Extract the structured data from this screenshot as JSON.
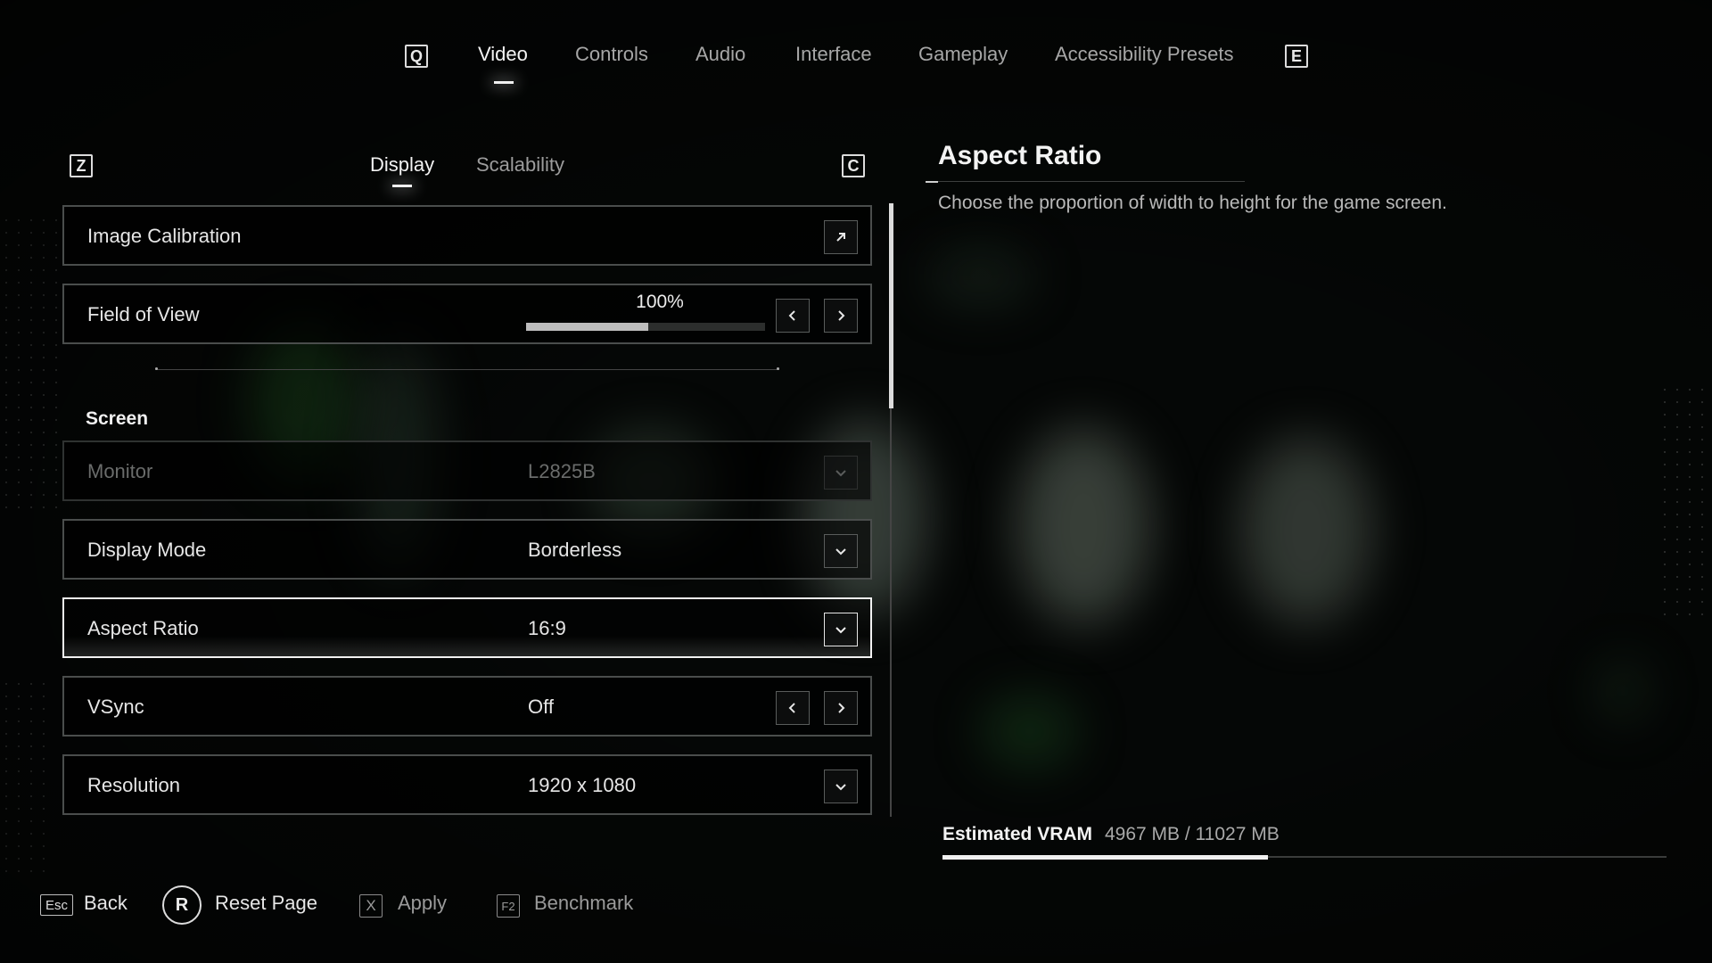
{
  "top_nav": {
    "left_key": "Q",
    "right_key": "E",
    "tabs": [
      {
        "label": "Video",
        "active": true
      },
      {
        "label": "Controls",
        "active": false
      },
      {
        "label": "Audio",
        "active": false
      },
      {
        "label": "Interface",
        "active": false
      },
      {
        "label": "Gameplay",
        "active": false
      },
      {
        "label": "Accessibility Presets",
        "active": false
      }
    ]
  },
  "sub_nav": {
    "left_key": "Z",
    "right_key": "C",
    "tabs": [
      {
        "label": "Display",
        "active": true
      },
      {
        "label": "Scalability",
        "active": false
      }
    ]
  },
  "settings": {
    "image_calibration": {
      "label": "Image Calibration",
      "icon": "external-link-icon"
    },
    "field_of_view": {
      "label": "Field of View",
      "value": "100%",
      "slider_fraction": 0.51
    },
    "section_screen": "Screen",
    "monitor": {
      "label": "Monitor",
      "value": "L2825B",
      "disabled": true
    },
    "display_mode": {
      "label": "Display Mode",
      "value": "Borderless"
    },
    "aspect_ratio": {
      "label": "Aspect Ratio",
      "value": "16:9",
      "selected": true
    },
    "vsync": {
      "label": "VSync",
      "value": "Off"
    },
    "resolution": {
      "label": "Resolution",
      "value": "1920 x 1080"
    }
  },
  "detail": {
    "title": "Aspect Ratio",
    "description": "Choose the proportion of width to height for the game screen."
  },
  "vram": {
    "label": "Estimated VRAM",
    "value": "4967 MB / 11027 MB",
    "fraction": 0.45
  },
  "footer": {
    "back": {
      "key": "Esc",
      "label": "Back"
    },
    "reset": {
      "key": "R",
      "label": "Reset Page"
    },
    "apply": {
      "key": "X",
      "label": "Apply"
    },
    "benchmark": {
      "key": "F2",
      "label": "Benchmark"
    }
  },
  "colors": {
    "background": "#050706",
    "text": "#e8e8e8",
    "muted": "#a6a6a6",
    "border": "#4a4d4c",
    "selected_border": "#f2f2f2"
  }
}
